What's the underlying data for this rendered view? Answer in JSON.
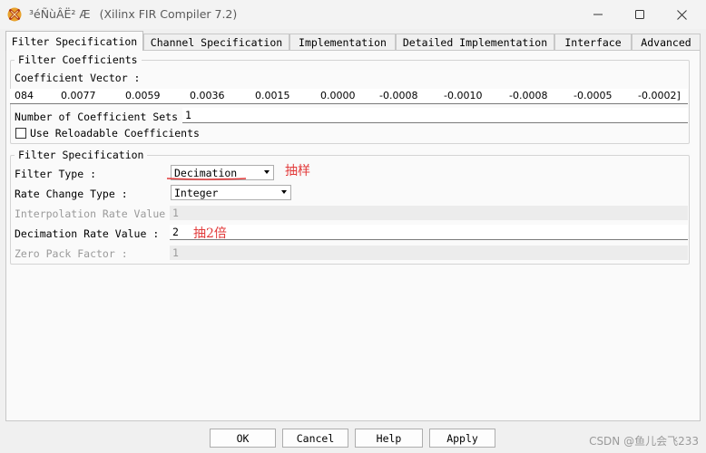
{
  "window": {
    "title_garbled": "³éÑùÂË² Æ",
    "title_main": "(Xilinx FIR Compiler 7.2)",
    "controls": {
      "minimize": "—",
      "maximize": "☐",
      "close": "✕"
    }
  },
  "tabs": [
    {
      "label": "Filter Specification",
      "active": true
    },
    {
      "label": "Channel Specification",
      "active": false
    },
    {
      "label": "Implementation",
      "active": false
    },
    {
      "label": "Detailed Implementation",
      "active": false
    },
    {
      "label": "Interface",
      "active": false
    },
    {
      "label": "Advanced",
      "active": false
    }
  ],
  "filter_coefficients": {
    "legend": "Filter Coefficients",
    "vector_label": "Coefficient Vector :",
    "vector_values": [
      "084",
      "0.0077",
      "0.0059",
      "0.0036",
      "0.0015",
      "0.0000",
      "-0.0008",
      "-0.0010",
      "-0.0008",
      "-0.0005",
      "-0.0002]"
    ],
    "num_sets_label": "Number of Coefficient Sets :",
    "num_sets_value": "1",
    "reloadable_label": "Use Reloadable Coefficients",
    "reloadable_checked": false
  },
  "filter_specification": {
    "legend": "Filter Specification",
    "filter_type_label": "Filter Type :",
    "filter_type_value": "Decimation",
    "rate_change_label": "Rate Change Type :",
    "rate_change_value": "Integer",
    "interp_label": "Interpolation Rate Value :",
    "interp_value": "1",
    "decim_label": "Decimation Rate Value :",
    "decim_value": "2",
    "zero_pack_label": "Zero Pack Factor :",
    "zero_pack_value": "1"
  },
  "annotations": {
    "filter_type_note": "抽样",
    "decim_note": "抽2倍",
    "color": "#e23a3a"
  },
  "buttons": {
    "ok": "OK",
    "cancel": "Cancel",
    "help": "Help",
    "apply": "Apply"
  },
  "watermark": "CSDN @鱼儿会飞233"
}
